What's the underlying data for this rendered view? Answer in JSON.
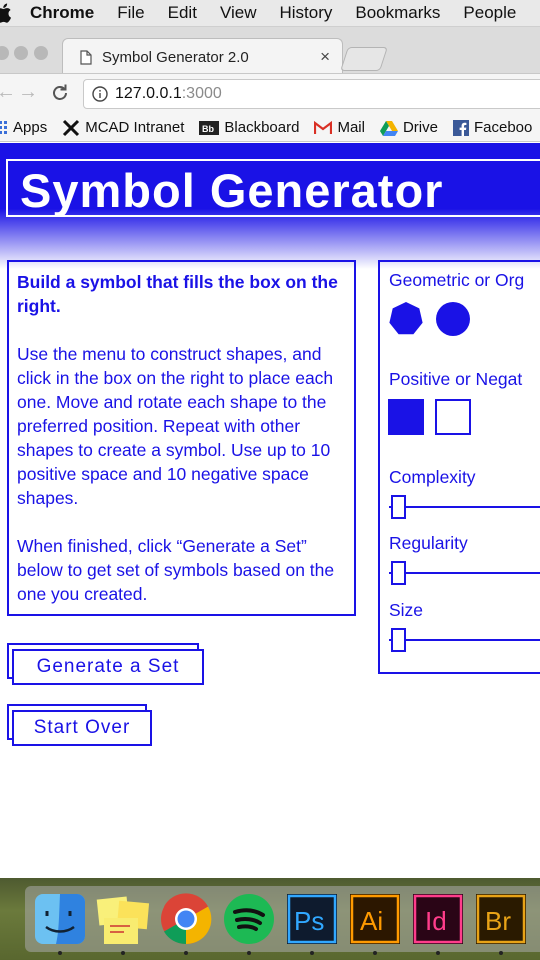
{
  "menubar": {
    "app_name": "Chrome",
    "items": [
      "File",
      "Edit",
      "View",
      "History",
      "Bookmarks",
      "People"
    ]
  },
  "tab": {
    "title": "Symbol Generator 2.0",
    "close_glyph": "×"
  },
  "omnibox": {
    "host": "127.0.0.1",
    "port": ":3000"
  },
  "bookmarks": [
    {
      "label": "Apps",
      "icon": "apps-grid-icon"
    },
    {
      "label": "MCAD Intranet",
      "icon": "mcad-x-icon"
    },
    {
      "label": "Blackboard",
      "icon": "blackboard-icon"
    },
    {
      "label": "Mail",
      "icon": "gmail-icon"
    },
    {
      "label": "Drive",
      "icon": "drive-icon"
    },
    {
      "label": "Faceboo",
      "icon": "facebook-icon"
    }
  ],
  "page": {
    "title": "Symbol Generator",
    "accent_color": "#1a12e6",
    "instructions": {
      "lead": "Build a symbol that fills the box on the right.",
      "body": "Use the menu to construct shapes, and click in the box on the right to place each one. Move and rotate each shape to the preferred position. Repeat with other shapes to create a symbol. Use up to 10 positive space and 10 negative space shapes.",
      "finish": "When finished, click “Generate a Set” below to get set of symbols based on the one you created."
    },
    "controls": {
      "shape_type_label": "Geometric or Org",
      "space_label": "Positive or Negat",
      "complexity_label": "Complexity",
      "regularity_label": "Regularity",
      "size_label": "Size",
      "complexity_value": 0,
      "regularity_value": 0,
      "size_value": 0
    },
    "buttons": {
      "generate": "Generate a Set",
      "start_over": "Start Over"
    }
  },
  "dock": {
    "apps": [
      {
        "name": "Finder",
        "icon": "finder-icon"
      },
      {
        "name": "Stickies",
        "icon": "stickies-icon"
      },
      {
        "name": "Chrome",
        "icon": "chrome-icon"
      },
      {
        "name": "Spotify",
        "icon": "spotify-icon"
      },
      {
        "name": "Photoshop",
        "icon": "photoshop-icon",
        "glyph": "Ps"
      },
      {
        "name": "Illustrator",
        "icon": "illustrator-icon",
        "glyph": "Ai"
      },
      {
        "name": "InDesign",
        "icon": "indesign-icon",
        "glyph": "Id"
      },
      {
        "name": "Bridge",
        "icon": "bridge-icon",
        "glyph": "Br"
      }
    ]
  }
}
